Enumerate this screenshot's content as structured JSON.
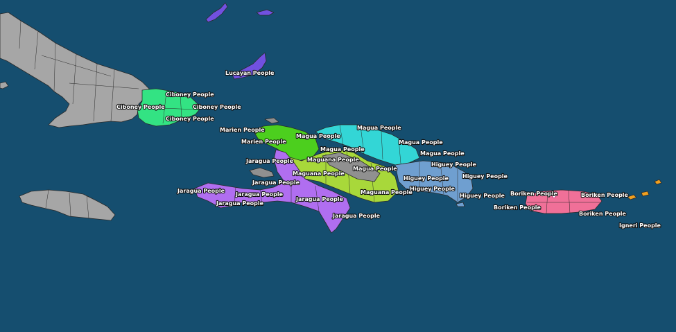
{
  "map": {
    "sea_color": "#154e6f",
    "regions": [
      {
        "id": "cuba",
        "name": "",
        "color": "#a6a6a6"
      },
      {
        "id": "jamaica",
        "name": "",
        "color": "#a6a6a6"
      },
      {
        "id": "ciboney",
        "name": "Ciboney People",
        "color": "#33e383"
      },
      {
        "id": "lucayan",
        "name": "Lucayan People",
        "color": "#7151e0"
      },
      {
        "id": "marien",
        "name": "Marien People",
        "color": "#4ccf1e"
      },
      {
        "id": "magua",
        "name": "Magua People",
        "color": "#33d6d6"
      },
      {
        "id": "maguana",
        "name": "Maguana People",
        "color": "#a8d83a"
      },
      {
        "id": "jaragua",
        "name": "Jaragua People",
        "color": "#b06ef0"
      },
      {
        "id": "higuey",
        "name": "Higuey People",
        "color": "#6f9fd0"
      },
      {
        "id": "boriken",
        "name": "Boriken People",
        "color": "#f07098"
      },
      {
        "id": "igneri",
        "name": "Igneri People",
        "color": "#f0a020"
      },
      {
        "id": "neutral",
        "name": "",
        "color": "#909090"
      }
    ]
  },
  "labels": [
    {
      "text": "Lucayan People"
    },
    {
      "text": "Ciboney People"
    },
    {
      "text": "Ciboney People"
    },
    {
      "text": "Ciboney People"
    },
    {
      "text": "Ciboney People"
    },
    {
      "text": "Marien People"
    },
    {
      "text": "Marien People"
    },
    {
      "text": "Magua People"
    },
    {
      "text": "Magua People"
    },
    {
      "text": "Magua People"
    },
    {
      "text": "Magua People"
    },
    {
      "text": "Magua People"
    },
    {
      "text": "Magua People"
    },
    {
      "text": "Maguana People"
    },
    {
      "text": "Maguana People"
    },
    {
      "text": "Maguana People"
    },
    {
      "text": "Jaragua People"
    },
    {
      "text": "Jaragua People"
    },
    {
      "text": "Jaragua People"
    },
    {
      "text": "Jaragua People"
    },
    {
      "text": "Jaragua People"
    },
    {
      "text": "Jaragua People"
    },
    {
      "text": "Jaragua People"
    },
    {
      "text": "Higuey People"
    },
    {
      "text": "Higuey People"
    },
    {
      "text": "Higuey People"
    },
    {
      "text": "Higuey People"
    },
    {
      "text": "Higuey People"
    },
    {
      "text": "Boriken People"
    },
    {
      "text": "Boriken People"
    },
    {
      "text": "Boriken People"
    },
    {
      "text": "Boriken People"
    },
    {
      "text": "Igneri People"
    }
  ]
}
